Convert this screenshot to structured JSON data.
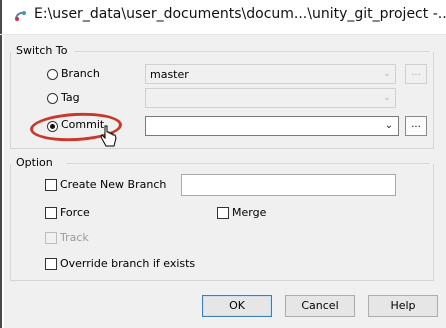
{
  "window": {
    "title": "E:\\user_data\\user_documents\\docum...\\unity_git_project -...",
    "icon": "tortoisegit-switch-icon"
  },
  "switch_to": {
    "group_label": "Switch To",
    "options": [
      {
        "label": "Branch",
        "selected": false,
        "enabled": true,
        "value": "master"
      },
      {
        "label": "Tag",
        "selected": false,
        "enabled": true,
        "value": ""
      },
      {
        "label": "Commit",
        "selected": true,
        "enabled": true,
        "value": ""
      }
    ],
    "browse_label": "..."
  },
  "option": {
    "group_label": "Option",
    "create_new_branch": {
      "label": "Create New Branch",
      "checked": false,
      "value": ""
    },
    "force": {
      "label": "Force",
      "checked": false
    },
    "merge": {
      "label": "Merge",
      "checked": false
    },
    "track": {
      "label": "Track",
      "checked": false,
      "enabled": false
    },
    "override": {
      "label": "Override branch if exists",
      "checked": false
    }
  },
  "buttons": {
    "ok": "OK",
    "cancel": "Cancel",
    "help": "Help"
  },
  "annotation": {
    "highlight_color": "#c8392b"
  }
}
